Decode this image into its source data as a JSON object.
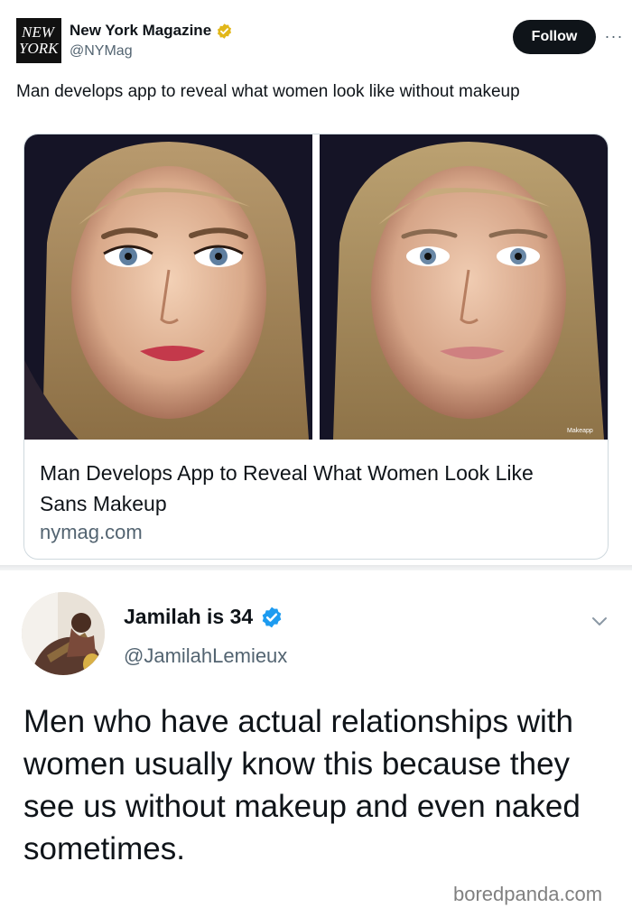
{
  "tweet1": {
    "avatar": {
      "logo_text_line1": "NEW",
      "logo_text_line2": "YORK",
      "icon": "new-york-magazine-logo"
    },
    "display_name": "New York Magazine",
    "verified_badge": {
      "icon": "gold-verified-badge",
      "color": "#e2b719"
    },
    "handle": "@NYMag",
    "follow_label": "Follow",
    "more_label": "···",
    "text": "Man develops app to reveal what women look like without makeup",
    "card": {
      "image_left": "woman-with-makeup-photo",
      "image_right": "woman-without-makeup-photo",
      "image_watermark": "Makeapp",
      "title": "Man Develops App to Reveal What Women Look Like Sans Makeup",
      "domain": "nymag.com"
    }
  },
  "tweet2": {
    "avatar": "profile-photo",
    "display_name": "Jamilah is 34",
    "verified_badge": {
      "icon": "blue-verified-badge",
      "color": "#1d9bf0"
    },
    "handle": "@JamilahLemieux",
    "menu_icon": "chevron-down-icon",
    "text": "Men who have actual relationships with women usually know this because they see us without makeup and even naked sometimes."
  },
  "watermark": "boredpanda.com",
  "colors": {
    "text_primary": "#0f1419",
    "text_secondary": "#536471",
    "follow_bg": "#0f1419",
    "border": "#cfd9de"
  }
}
